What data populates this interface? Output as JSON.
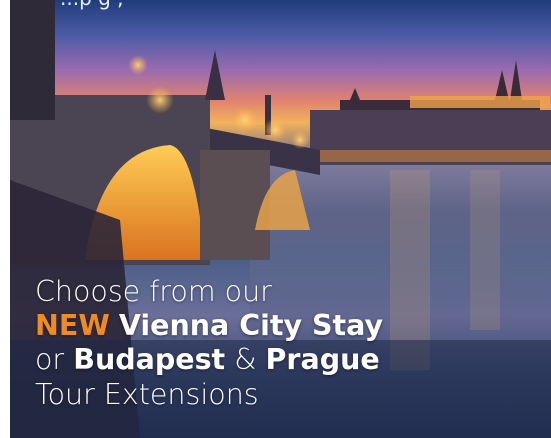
{
  "promo": {
    "top_fragment": "...p g    ,",
    "line1": "Choose from our",
    "line2_accent": "NEW",
    "line2_rest": "Vienna City Stay",
    "line3_or": "or",
    "line3_city1": "Budapest",
    "line3_amp": "&",
    "line3_city2": "Prague",
    "line4": "Tour Extensions"
  },
  "colors": {
    "accent": "#f28a22",
    "text": "#ffffff"
  }
}
